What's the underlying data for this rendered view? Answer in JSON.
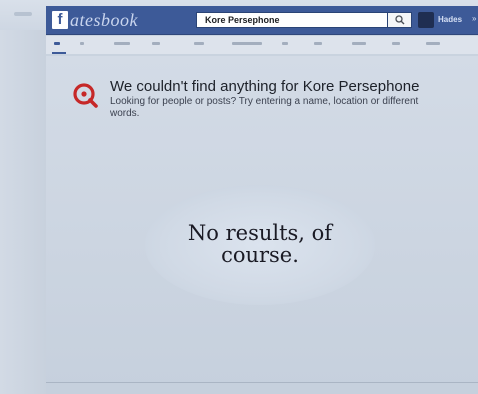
{
  "header": {
    "logo_mark": "f",
    "logo_text": "atesbook",
    "search_value": "Kore Persephone",
    "search_icon": "search-icon",
    "profile_name": "Hades",
    "more_label": "»"
  },
  "results": {
    "headline": "We couldn't find anything for Kore Persephone",
    "subtext": "Looking for people or posts? Try entering a name, location or different words.",
    "icon": "search-magnifier-icon",
    "icon_color": "#c62828"
  },
  "caption": {
    "line1": "No results, of",
    "line2": "course."
  },
  "colors": {
    "header_blue": "#3d5a98"
  }
}
